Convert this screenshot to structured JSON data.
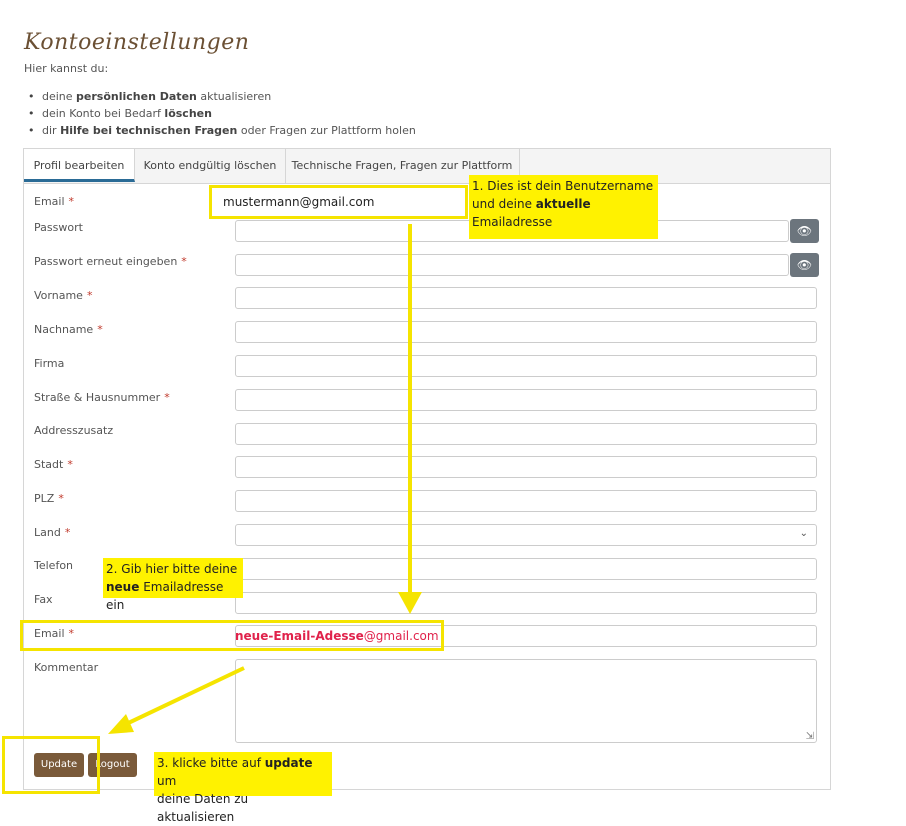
{
  "page": {
    "title": "Kontoeinstellungen",
    "intro": "Hier kannst du:",
    "bullets": [
      {
        "pre": "deine ",
        "bold": "persönlichen Daten",
        "post": " aktualisieren"
      },
      {
        "pre": "dein Konto bei Bedarf ",
        "bold": "löschen",
        "post": ""
      },
      {
        "pre": "dir ",
        "bold": "Hilfe bei technischen Fragen",
        "post": " oder Fragen zur Plattform holen"
      }
    ]
  },
  "tabs": [
    "Profil bearbeiten",
    "Konto endgültig löschen",
    "Technische Fragen, Fragen zur Plattform"
  ],
  "form": {
    "email_label": "Email",
    "email_value": "mustermann@gmail.com",
    "password_label": "Passwort",
    "password_repeat_label": "Passwort erneut eingeben",
    "firstname_label": "Vorname",
    "lastname_label": "Nachname",
    "company_label": "Firma",
    "street_label": "Straße & Hausnummer",
    "address_extra_label": "Addresszusatz",
    "city_label": "Stadt",
    "zip_label": "PLZ",
    "country_label": "Land",
    "phone_label": "Telefon",
    "fax_label": "Fax",
    "email2_label": "Email",
    "email2_value_bold": "neue-Email-Adesse",
    "email2_value_rest": "@gmail.com",
    "comment_label": "Kommentar",
    "required_mark": "*"
  },
  "buttons": {
    "update": "Update",
    "logout": "Logout"
  },
  "annotations": {
    "note1_line1": "1. Dies ist dein Benutzername",
    "note1_line2_pre": "und deine ",
    "note1_line2_bold": "aktuelle",
    "note1_line3": "Emailadresse",
    "note2_line1": "2. Gib hier bitte deine",
    "note2_line2_bold": "neue",
    "note2_line2_rest": " Emailadresse ein",
    "note3_line1_pre": "3. klicke bitte auf ",
    "note3_line1_bold": "update",
    "note3_line1_post": " um",
    "note3_line2": "deine Daten zu aktualisieren"
  },
  "colors": {
    "accent_brown": "#7a5a3a",
    "highlight_yellow": "#fff200",
    "tab_active": "#2a6b96",
    "required_red": "#c0392b"
  }
}
